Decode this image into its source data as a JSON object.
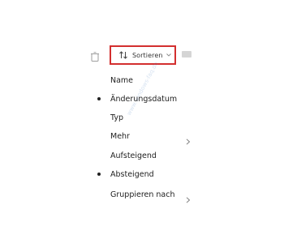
{
  "toolbar": {
    "trash_icon": "trash-icon",
    "sort_button_label": "Sortieren",
    "sort_icon": "sort-arrows-icon",
    "sort_chevron_icon": "chevron-down-icon",
    "highlight_color": "#d32f2f"
  },
  "sort_menu": {
    "items": [
      {
        "label": "Name",
        "selected": false,
        "has_submenu": false
      },
      {
        "label": "Änderungsdatum",
        "selected": true,
        "has_submenu": false
      },
      {
        "label": "Typ",
        "selected": false,
        "has_submenu": false
      },
      {
        "label": "Mehr",
        "selected": false,
        "has_submenu": true
      },
      {
        "label": "Aufsteigend",
        "selected": false,
        "has_submenu": false
      },
      {
        "label": "Absteigend",
        "selected": true,
        "has_submenu": false
      },
      {
        "label": "Gruppieren nach",
        "selected": false,
        "has_submenu": true
      }
    ],
    "selected_marker_icon": "bullet-icon",
    "submenu_icon": "chevron-right-icon"
  }
}
